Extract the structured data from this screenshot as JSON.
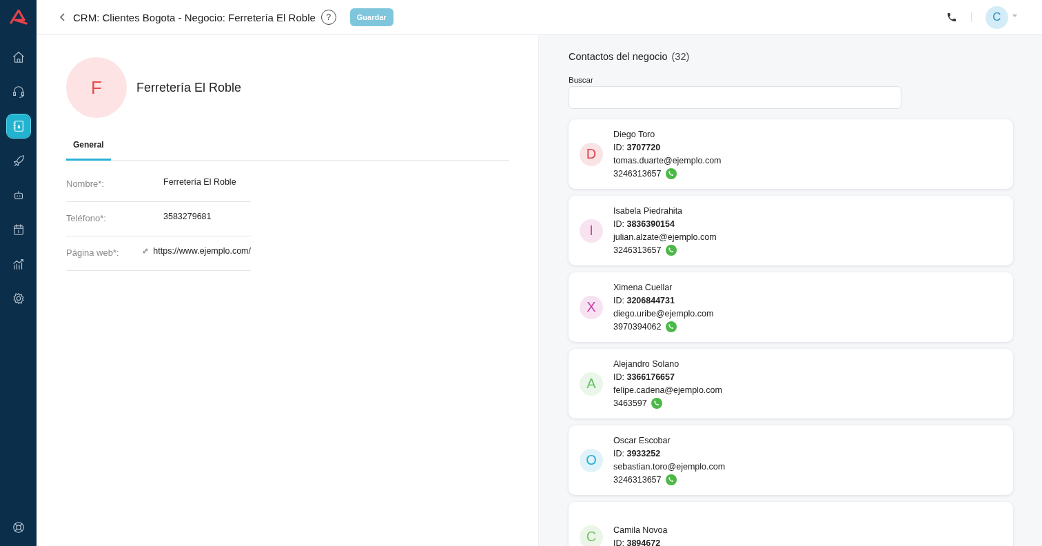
{
  "sidebar": {
    "items": [
      {
        "selected": false
      },
      {
        "selected": false
      },
      {
        "selected": true
      },
      {
        "selected": false
      },
      {
        "selected": false
      },
      {
        "selected": false
      },
      {
        "selected": false
      },
      {
        "selected": false
      }
    ]
  },
  "header": {
    "title": "CRM: Clientes Bogota - Negocio: Ferretería El Roble",
    "help": "?",
    "save_button": {
      "label": "Guardar",
      "disabled": true
    },
    "user_avatar": "C"
  },
  "business": {
    "initial": "F",
    "name": "Ferretería El Roble"
  },
  "tabs": [
    {
      "label": "General",
      "selected": true
    }
  ],
  "fields": [
    {
      "label": "Nombre*:",
      "value": "Ferretería El Roble",
      "kind": "text"
    },
    {
      "label": "Teléfono*:",
      "value": "3583279681",
      "kind": "text"
    },
    {
      "label": "Página web*:",
      "value": "https://www.ejemplo.com/",
      "kind": "link"
    }
  ],
  "contacts_panel": {
    "title": "Contactos del negocio",
    "count": "(32)",
    "search_label": "Buscar",
    "contacts": [
      {
        "initial": "D",
        "color": "#e0464f",
        "name": "Diego Toro",
        "id": "ID: **3707720**",
        "email": "tomas.duarte@ejemplo.com",
        "phone": "3246313657"
      },
      {
        "initial": "I",
        "color": "#d0459a",
        "name": "Isabela Piedrahita",
        "id": "ID: **3836390154**",
        "email": "julian.alzate@ejemplo.com",
        "phone": "3246313657"
      },
      {
        "initial": "X",
        "color": "#cc3fa8",
        "name": "Ximena Cuellar",
        "id": "ID: **3206844731**",
        "email": "diego.uribe@ejemplo.com",
        "phone": "3970394062"
      },
      {
        "initial": "A",
        "color": "#6cc06a",
        "name": "Alejandro Solano",
        "id": "ID: **3366176657**",
        "email": "felipe.cadena@ejemplo.com",
        "phone": "3463597"
      },
      {
        "initial": "O",
        "color": "#2aaed6",
        "name": "Oscar Escobar",
        "id": "ID: **3933252**",
        "email": "sebastian.toro@ejemplo.com",
        "phone": "3246313657"
      },
      {
        "initial": "C",
        "color": "#7cc46a",
        "name": "Camila Novoa",
        "id": "ID: **3894672**"
      }
    ]
  }
}
